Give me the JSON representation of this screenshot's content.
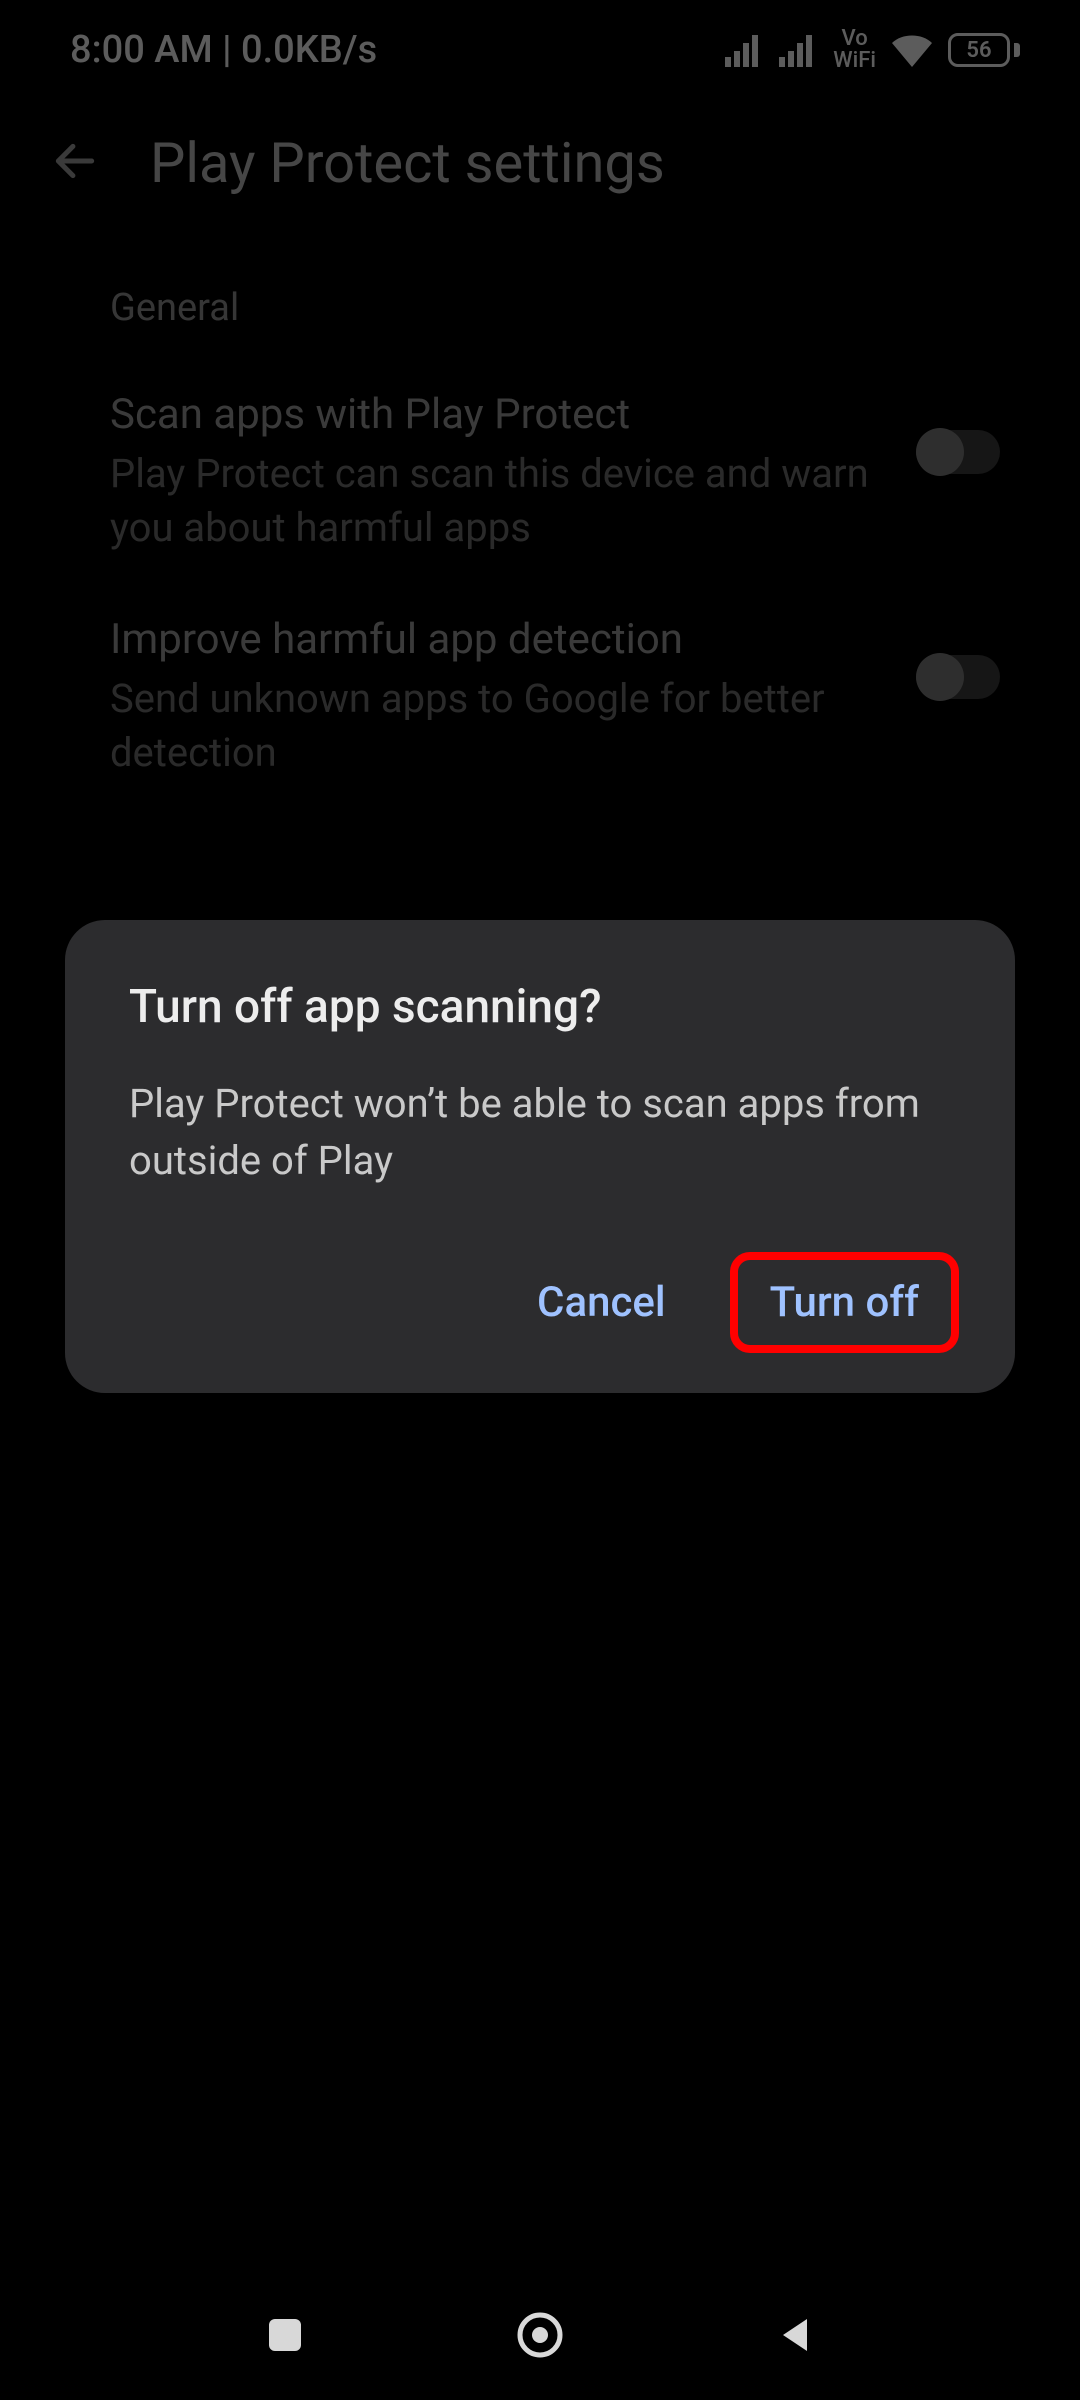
{
  "status": {
    "time": "8:00 AM",
    "net_rate": "0.0KB/s",
    "vowifi_top": "Vo",
    "vowifi_bot": "WiFi",
    "battery_pct": "56"
  },
  "header": {
    "title": "Play Protect settings"
  },
  "section_label": "General",
  "settings": [
    {
      "title": "Scan apps with Play Protect",
      "desc": "Play Protect can scan this device and warn you about harmful apps"
    },
    {
      "title": "Improve harmful app detection",
      "desc": "Send unknown apps to Google for better detection"
    }
  ],
  "dialog": {
    "title": "Turn off app scanning?",
    "body": "Play Protect won’t be able to scan apps from outside of Play",
    "cancel": "Cancel",
    "confirm": "Turn off"
  }
}
